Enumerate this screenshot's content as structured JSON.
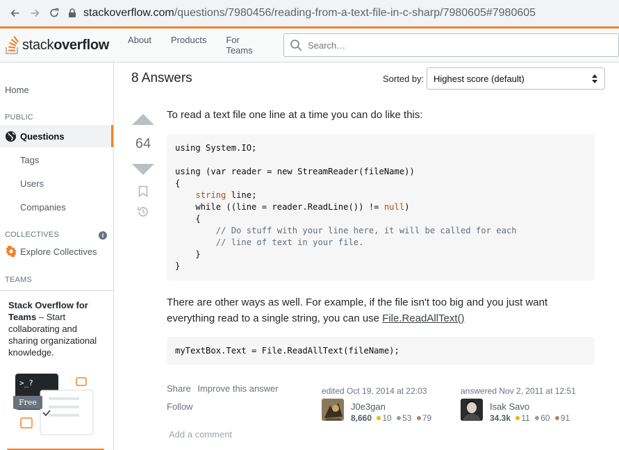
{
  "browser": {
    "url_host": "stackoverflow.com",
    "url_path": "/questions/7980456/reading-from-a-text-file-in-c-sharp/7980605#7980605"
  },
  "header": {
    "logo_left": "stack",
    "logo_right": "overflow",
    "nav": [
      "About",
      "Products",
      "For Teams"
    ],
    "search_placeholder": "Search…"
  },
  "sidebar": {
    "home": "Home",
    "public": "PUBLIC",
    "questions": "Questions",
    "tags": "Tags",
    "users": "Users",
    "companies": "Companies",
    "collectives": "COLLECTIVES",
    "explore": "Explore Collectives",
    "teams": "TEAMS",
    "teams_title": "Stack Overflow for Teams",
    "teams_text": " – Start collaborating and sharing organizational knowledge.",
    "free": "Free",
    "prompt": ">_?"
  },
  "main": {
    "answers_count": "8 Answers",
    "sorted_by": "Sorted by:",
    "sort_value": "Highest score (default)",
    "votes": "64",
    "intro": "To read a text file one line at a time you can do like this:",
    "code1": {
      "l1": "using System.IO;",
      "l2": "using (var reader = new StreamReader(fileName))",
      "l3": "{",
      "l4_kw": "string",
      "l4_rest": " line;",
      "l5_pre": "    while ((line = reader.ReadLine()) != ",
      "l5_null": "null",
      "l5_post": ")",
      "l6": "    {",
      "l7": "        // Do stuff with your line here, it will be called for each",
      "l8": "        // line of text in your file.",
      "l9": "    }",
      "l10": "}"
    },
    "other_text_1": "There are other ways as well. For example, if the file isn't too big and you just want",
    "other_text_2": "everything read to a single string, you can use ",
    "other_link": "File.ReadAllText()",
    "code2": "myTextBox.Text = File.ReadAllText(fileName);",
    "share": "Share",
    "improve": "Improve this answer",
    "follow": "Follow",
    "add_comment": "Add a comment",
    "editor": {
      "when": "edited Oct 19, 2014 at 22:03",
      "name": "J0e3gan",
      "rep": "8,660",
      "gold": "10",
      "silver": "53",
      "bronze": "79"
    },
    "author": {
      "when": "answered Nov 2, 2011 at 12:51",
      "name": "Isak Savo",
      "rep": "34.3k",
      "gold": "11",
      "silver": "60",
      "bronze": "91"
    }
  }
}
